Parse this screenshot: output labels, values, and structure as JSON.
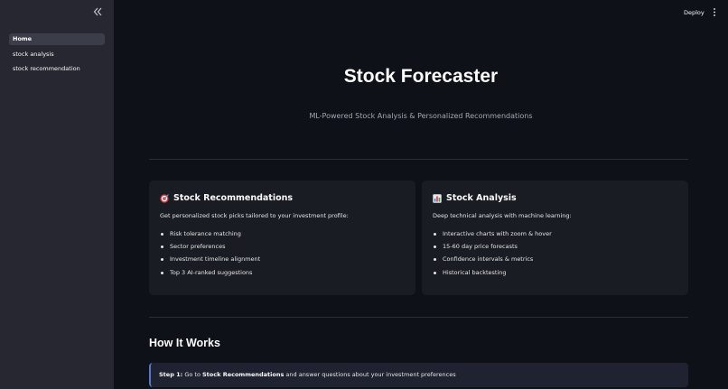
{
  "sidebar": {
    "collapse_icon": "double-chevron-left-icon",
    "items": [
      {
        "label": "Home",
        "active": true
      },
      {
        "label": "stock analysis",
        "active": false
      },
      {
        "label": "stock recommendation",
        "active": false
      }
    ]
  },
  "header": {
    "deploy_label": "Deploy",
    "menu_icon": "vertical-dots-icon"
  },
  "main": {
    "title": "Stock Forecaster",
    "subtitle": "ML-Powered Stock Analysis & Personalized Recommendations",
    "cards": [
      {
        "icon": "target-icon",
        "title": "Stock Recommendations",
        "description": "Get personalized stock picks tailored to your investment profile:",
        "bullets": [
          "Risk tolerance matching",
          "Sector preferences",
          "Investment timeline alignment",
          "Top 3 AI-ranked suggestions"
        ]
      },
      {
        "icon": "bar-chart-icon",
        "title": "Stock Analysis",
        "description": "Deep technical analysis with machine learning:",
        "bullets": [
          "Interactive charts with zoom & hover",
          "15-60 day price forecasts",
          "Confidence intervals & metrics",
          "Historical backtesting"
        ]
      }
    ],
    "how_it_works": {
      "title": "How It Works",
      "step1": {
        "label": "Step 1:",
        "pre": " Go to ",
        "link": "Stock Recommendations",
        "post": " and answer questions about your investment preferences"
      }
    }
  },
  "colors": {
    "background": "#0e1117",
    "sidebar": "#262730",
    "card": "#1a1c24",
    "accent": "#5a76c8"
  }
}
